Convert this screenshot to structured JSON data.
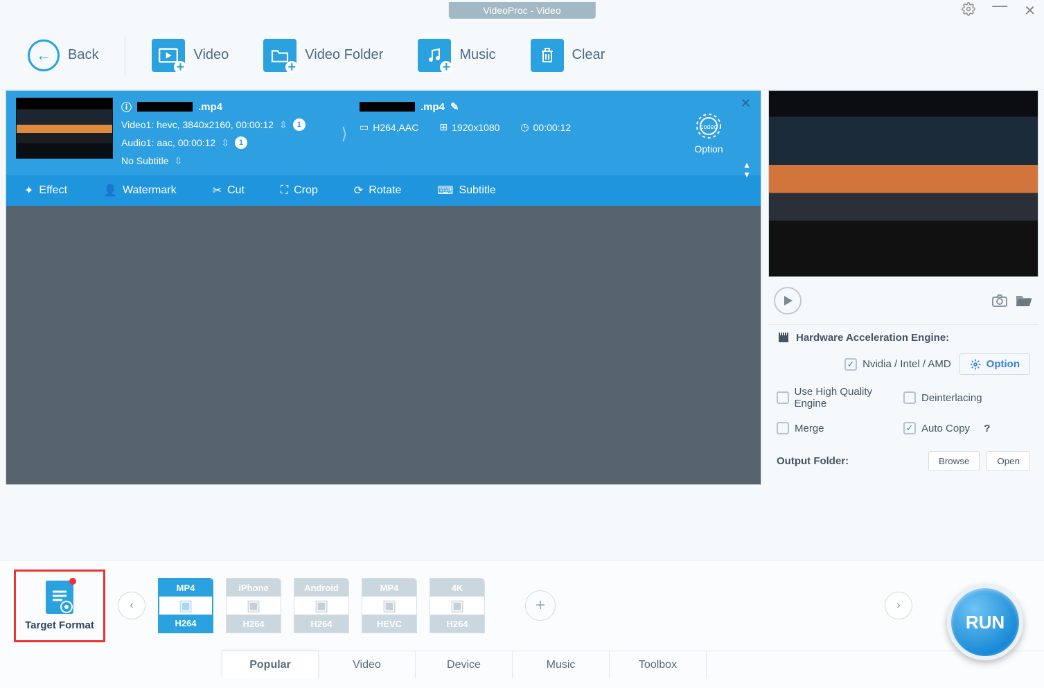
{
  "titlebar": {
    "title": "VideoProc - Video"
  },
  "toolbar": {
    "back": "Back",
    "video": "Video",
    "folder": "Video Folder",
    "music": "Music",
    "clear": "Clear"
  },
  "item": {
    "in_ext": ".mp4",
    "video_line": "Video1: hevc, 3840x2160, 00:00:12",
    "audio_line": "Audio1: aac, 00:00:12",
    "subtitle_line": "No Subtitle",
    "badge1": "1",
    "badge2": "1",
    "out_ext": ".mp4",
    "codec": "H264,AAC",
    "res": "1920x1080",
    "dur": "00:00:12",
    "option": "Option",
    "tabs": {
      "effect": "Effect",
      "watermark": "Watermark",
      "cut": "Cut",
      "crop": "Crop",
      "rotate": "Rotate",
      "subtitle": "Subtitle"
    }
  },
  "preview": {
    "hw_title": "Hardware Acceleration Engine:",
    "hw_label": "Nvidia / Intel / AMD",
    "option": "Option",
    "hq": "Use High Quality Engine",
    "deint": "Deinterlacing",
    "merge": "Merge",
    "autocopy": "Auto Copy",
    "outfolder": "Output Folder:",
    "browse": "Browse",
    "open": "Open"
  },
  "formats": {
    "target": "Target Format",
    "cards": [
      {
        "top": "MP4",
        "bot": "H264"
      },
      {
        "top": "iPhone",
        "bot": "H264"
      },
      {
        "top": "Android",
        "bot": "H264"
      },
      {
        "top": "MP4",
        "bot": "HEVC"
      },
      {
        "top": "4K",
        "bot": "H264"
      }
    ],
    "tabs": [
      "Popular",
      "Video",
      "Device",
      "Music",
      "Toolbox"
    ],
    "run": "RUN"
  }
}
